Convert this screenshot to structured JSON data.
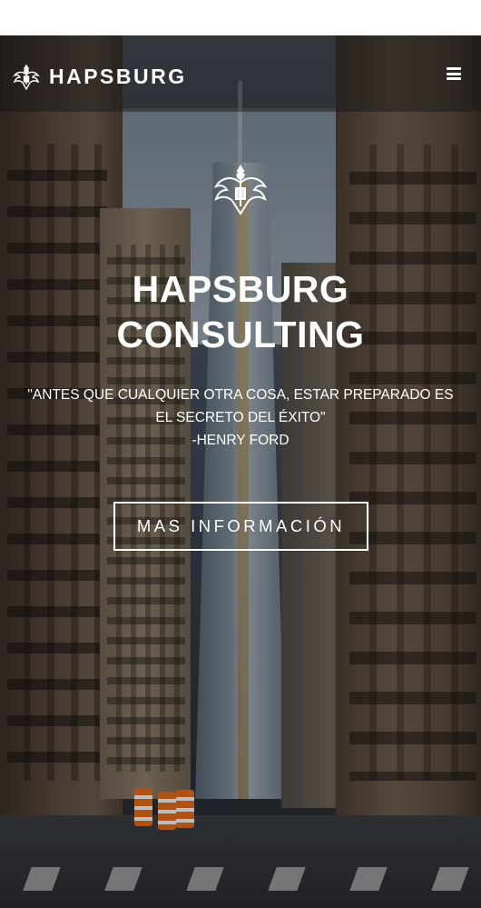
{
  "navbar": {
    "brand_name": "HAPSBURG",
    "logo_icon": "double-eagle-crest-icon",
    "menu_icon": "hamburger-menu-icon"
  },
  "hero": {
    "crest_icon": "double-eagle-crest-icon",
    "title_line1": "HAPSBURG",
    "title_line2": "CONSULTING",
    "quote": "\"ANTES QUE CUALQUIER OTRA COSA, ESTAR PREPARADO ES EL SECRETO DEL ÉXITO\"",
    "quote_author": "-HENRY FORD",
    "cta_label": "MAS INFORMACIÓN",
    "background": "city-street-skyscraper-photo"
  },
  "colors": {
    "text": "#ffffff",
    "navbar_bg": "#141414",
    "button_border": "#ffffff"
  }
}
